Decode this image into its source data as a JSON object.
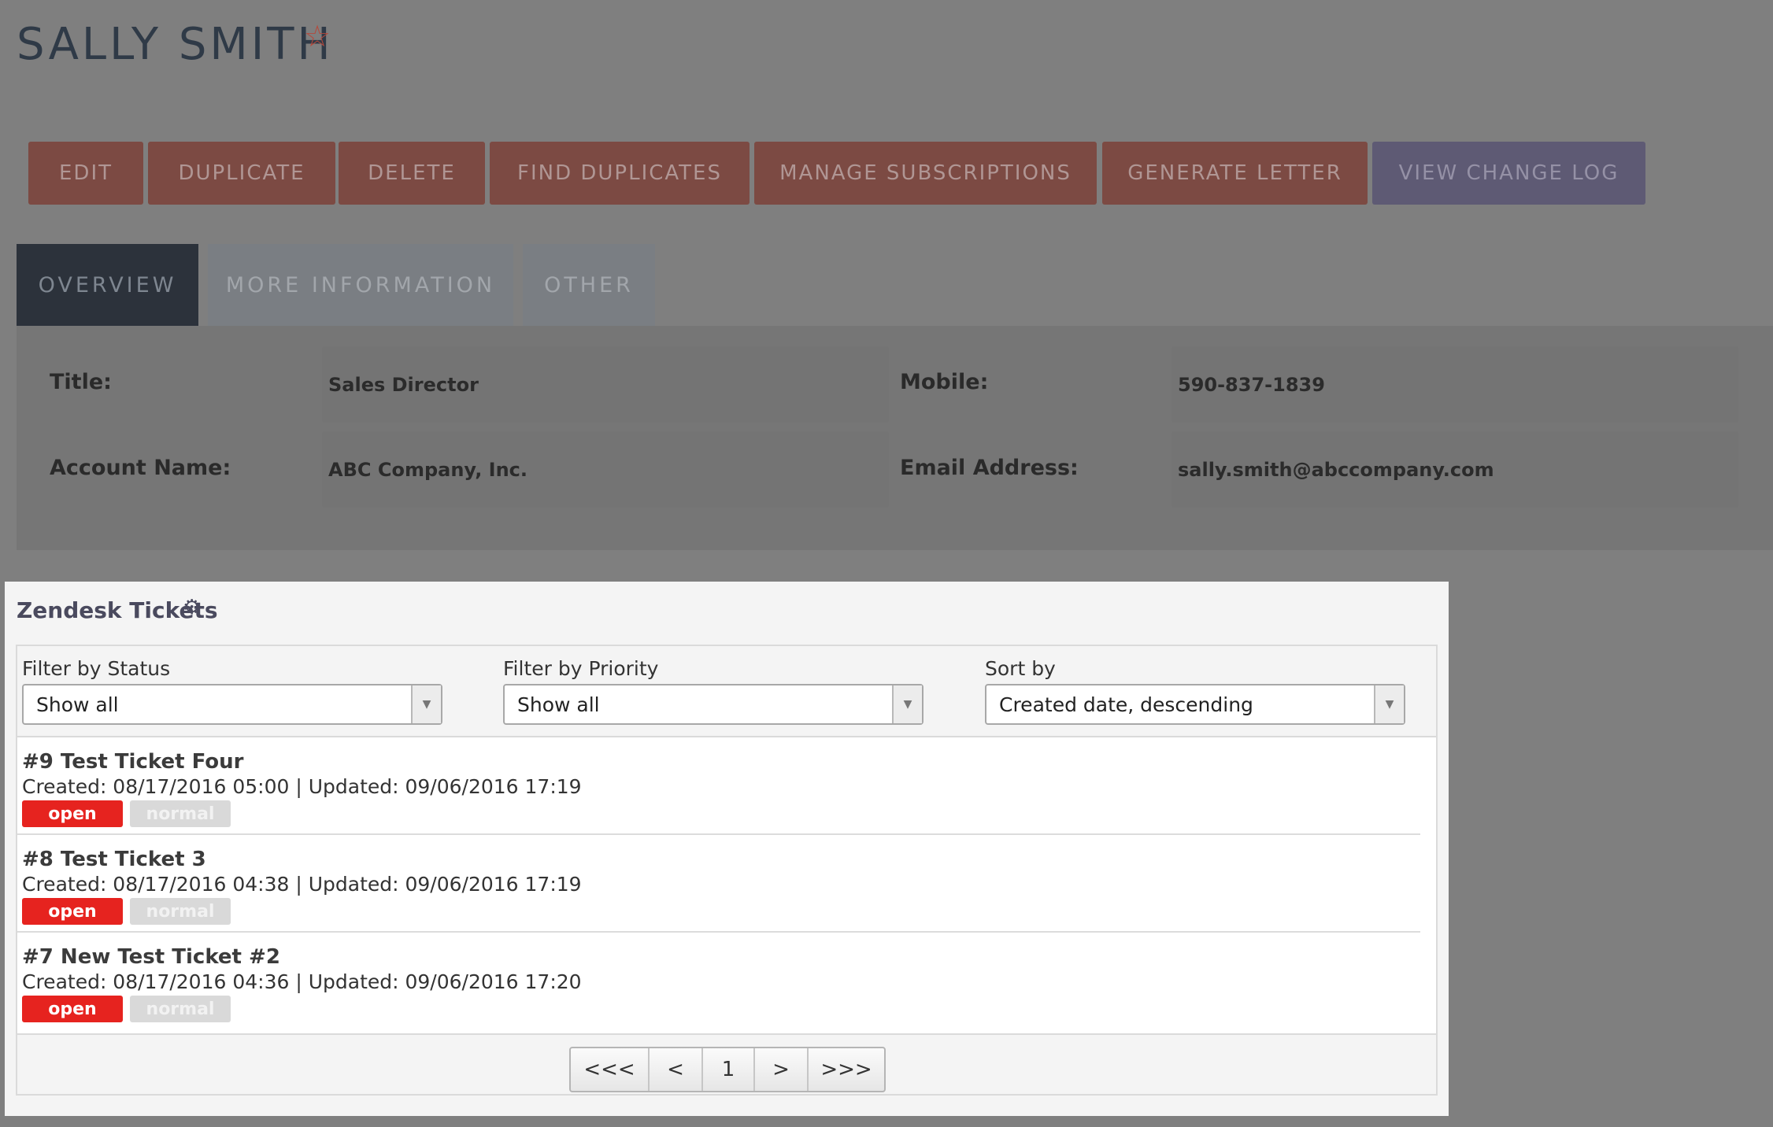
{
  "record": {
    "title": "SALLY SMITH",
    "favorite_icon": "star-outline-icon"
  },
  "actions": [
    {
      "label": "EDIT"
    },
    {
      "label": "DUPLICATE"
    },
    {
      "label": "DELETE"
    },
    {
      "label": "FIND DUPLICATES"
    },
    {
      "label": "MANAGE SUBSCRIPTIONS"
    },
    {
      "label": "GENERATE LETTER"
    },
    {
      "label": "VIEW CHANGE LOG"
    }
  ],
  "tabs": [
    {
      "label": "OVERVIEW",
      "active": true
    },
    {
      "label": "MORE INFORMATION",
      "active": false
    },
    {
      "label": "OTHER",
      "active": false
    }
  ],
  "overview": {
    "title_label": "Title:",
    "title_value": "Sales Director",
    "mobile_label": "Mobile:",
    "mobile_value": "590-837-1839",
    "account_label": "Account Name:",
    "account_value": "ABC Company, Inc.",
    "email_label": "Email Address:",
    "email_value": "sally.smith@abccompany.com"
  },
  "zendesk": {
    "title": "Zendesk Tickets",
    "settings_icon": "gear-icon",
    "filters": {
      "status_label": "Filter by Status",
      "status_value": "Show all",
      "priority_label": "Filter by Priority",
      "priority_value": "Show all",
      "sort_label": "Sort by",
      "sort_value": "Created date, descending"
    },
    "tickets": [
      {
        "title": "#9 Test Ticket Four",
        "meta": "Created: 08/17/2016 05:00 | Updated: 09/06/2016 17:19",
        "status": "open",
        "priority": "normal"
      },
      {
        "title": "#8 Test Ticket 3",
        "meta": "Created: 08/17/2016 04:38 | Updated: 09/06/2016 17:19",
        "status": "open",
        "priority": "normal"
      },
      {
        "title": "#7 New Test Ticket #2",
        "meta": "Created: 08/17/2016 04:36 | Updated: 09/06/2016 17:20",
        "status": "open",
        "priority": "normal"
      }
    ],
    "pagination": {
      "first": "<<<",
      "prev": "<",
      "current": "1",
      "next": ">",
      "last": ">>>"
    }
  },
  "colors": {
    "action_button": "#b5493c",
    "action_button_alt": "#7b6ab0",
    "status_open": "#e6231f",
    "priority_normal": "#d9d9d9",
    "overlay": "#7f7f7f"
  }
}
